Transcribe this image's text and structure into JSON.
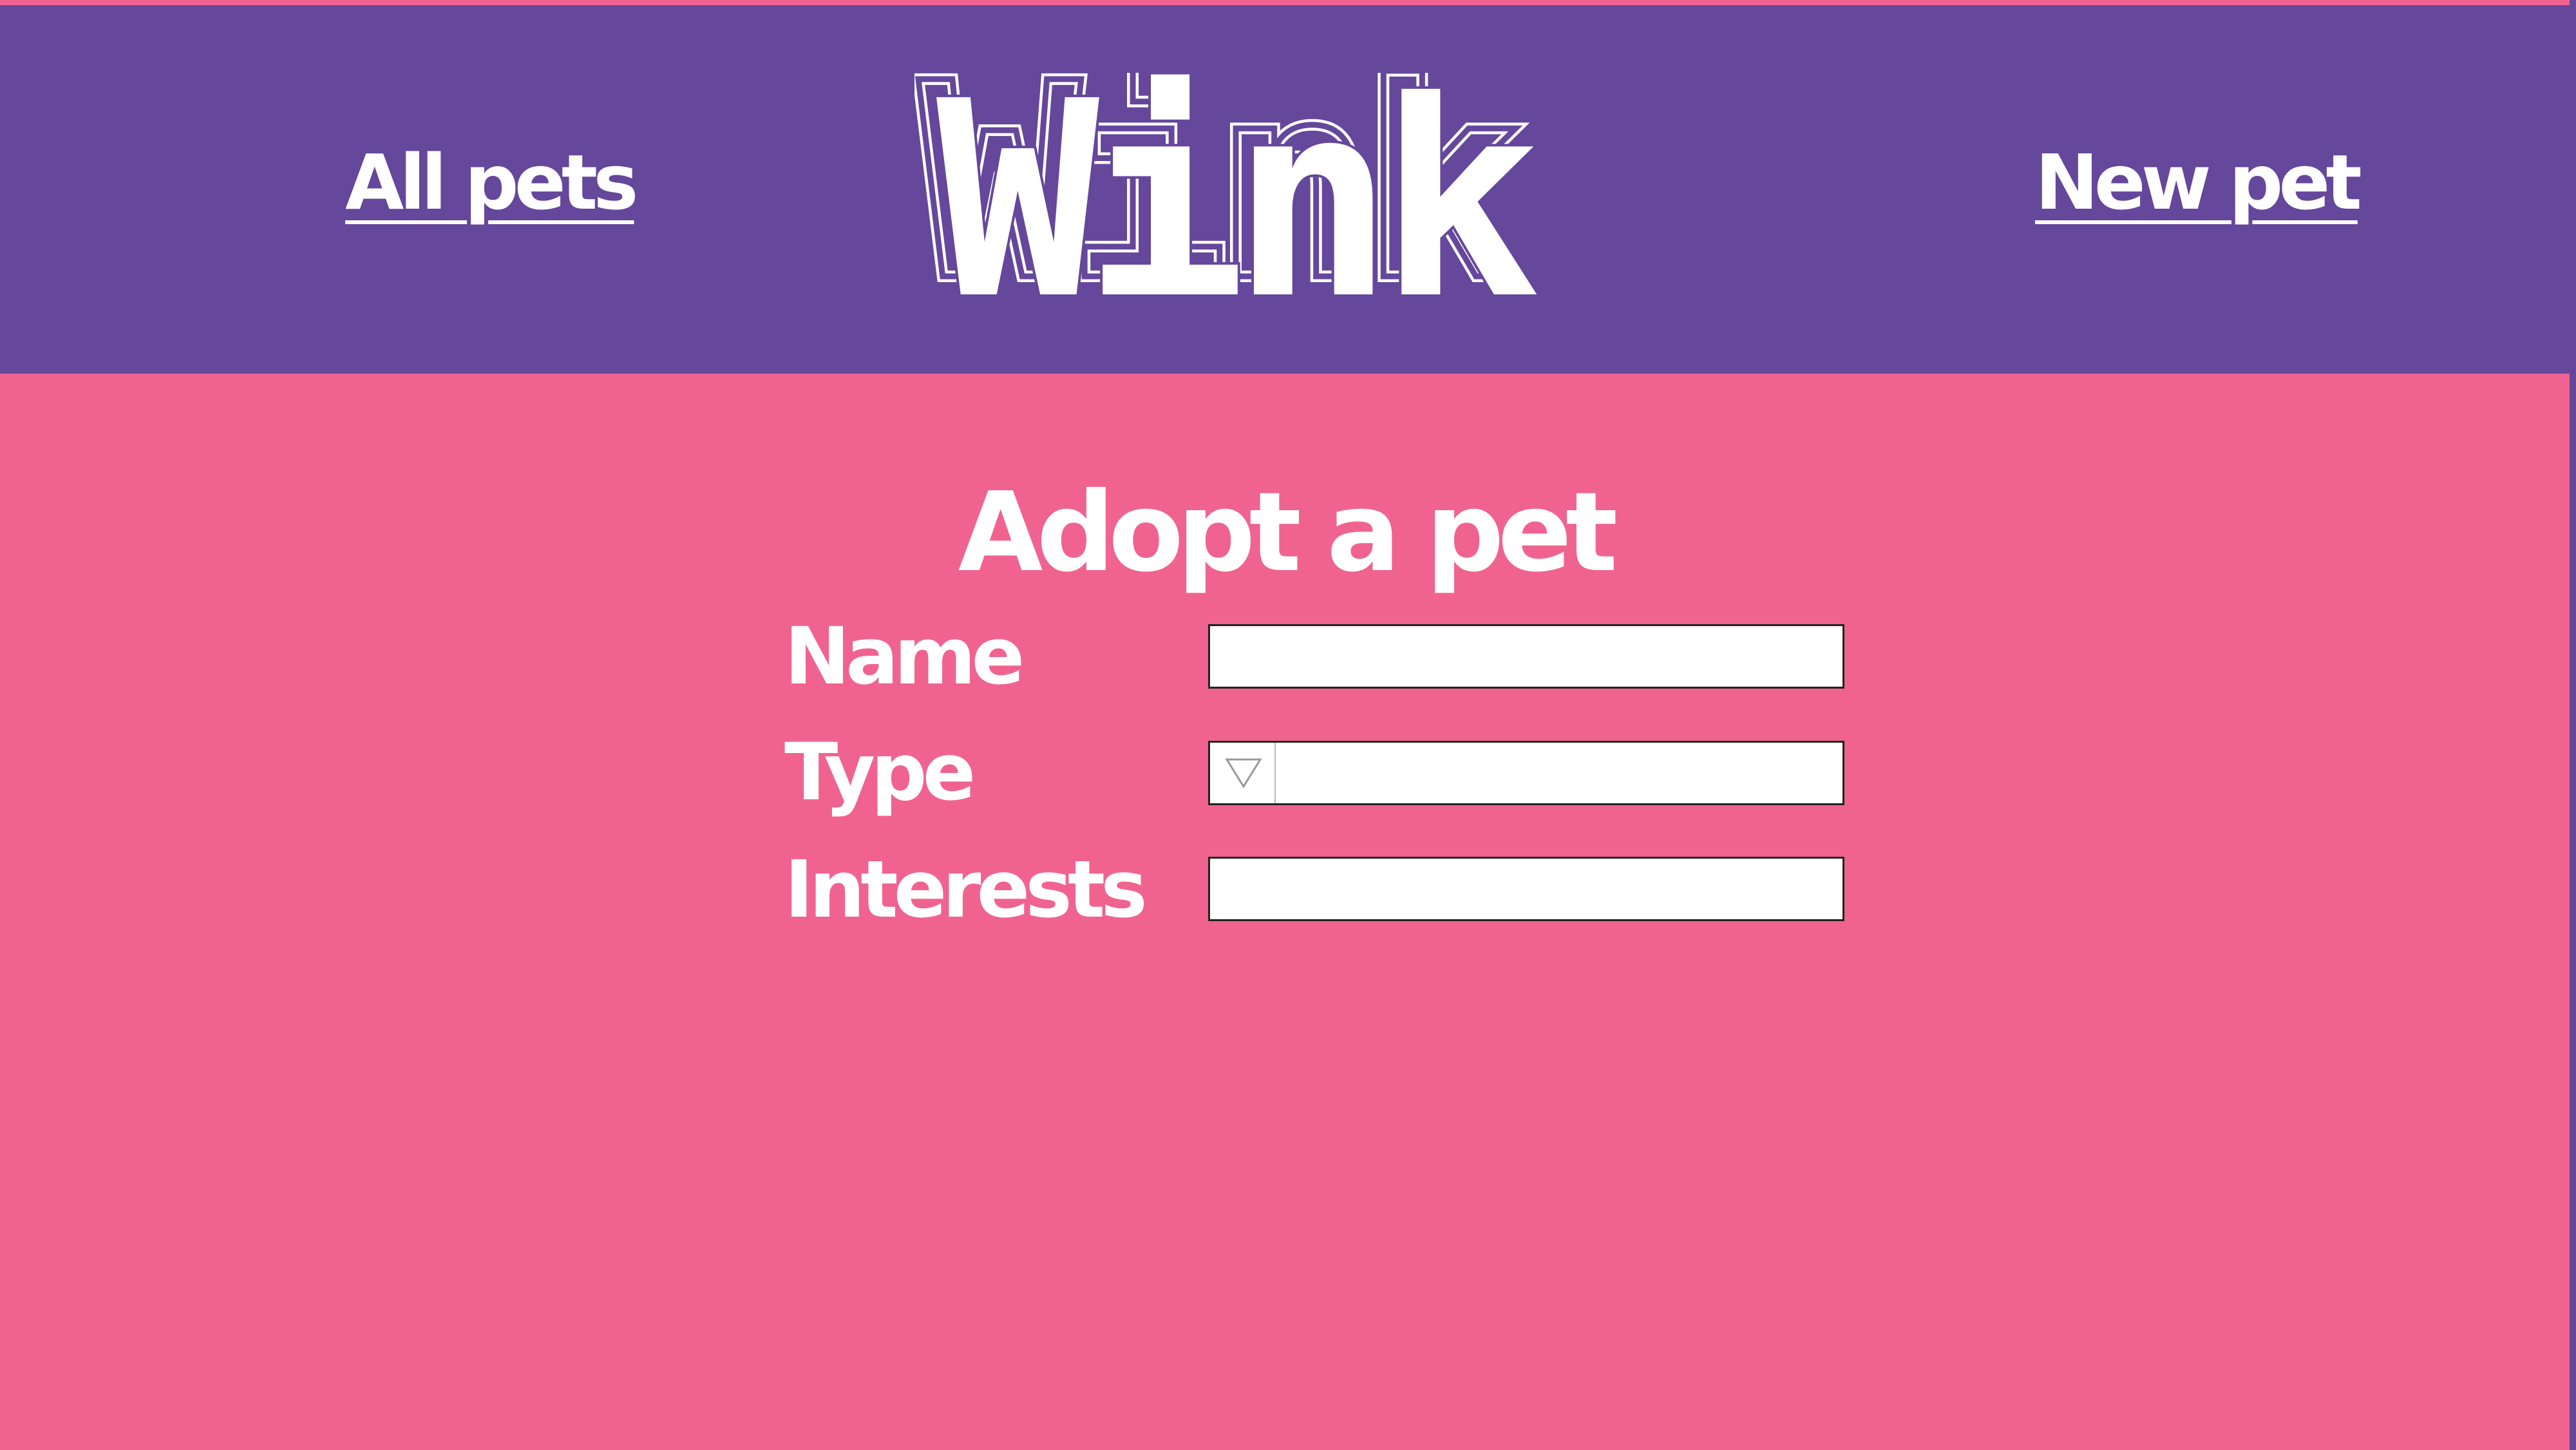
{
  "header": {
    "nav_left": "All pets",
    "nav_right": "New pet",
    "logo_text": "Wink"
  },
  "form": {
    "title": "Adopt a pet",
    "name_label": "Name",
    "name_value": "",
    "type_label": "Type",
    "type_value": "",
    "interests_label": "Interests",
    "interests_value": ""
  },
  "icons": {
    "type_dropdown": "triangle-down-icon"
  },
  "colors": {
    "background": "#f06390",
    "header": "#65479b",
    "text": "#ffffff",
    "input_background": "#ffffff",
    "input_border": "#222222"
  }
}
